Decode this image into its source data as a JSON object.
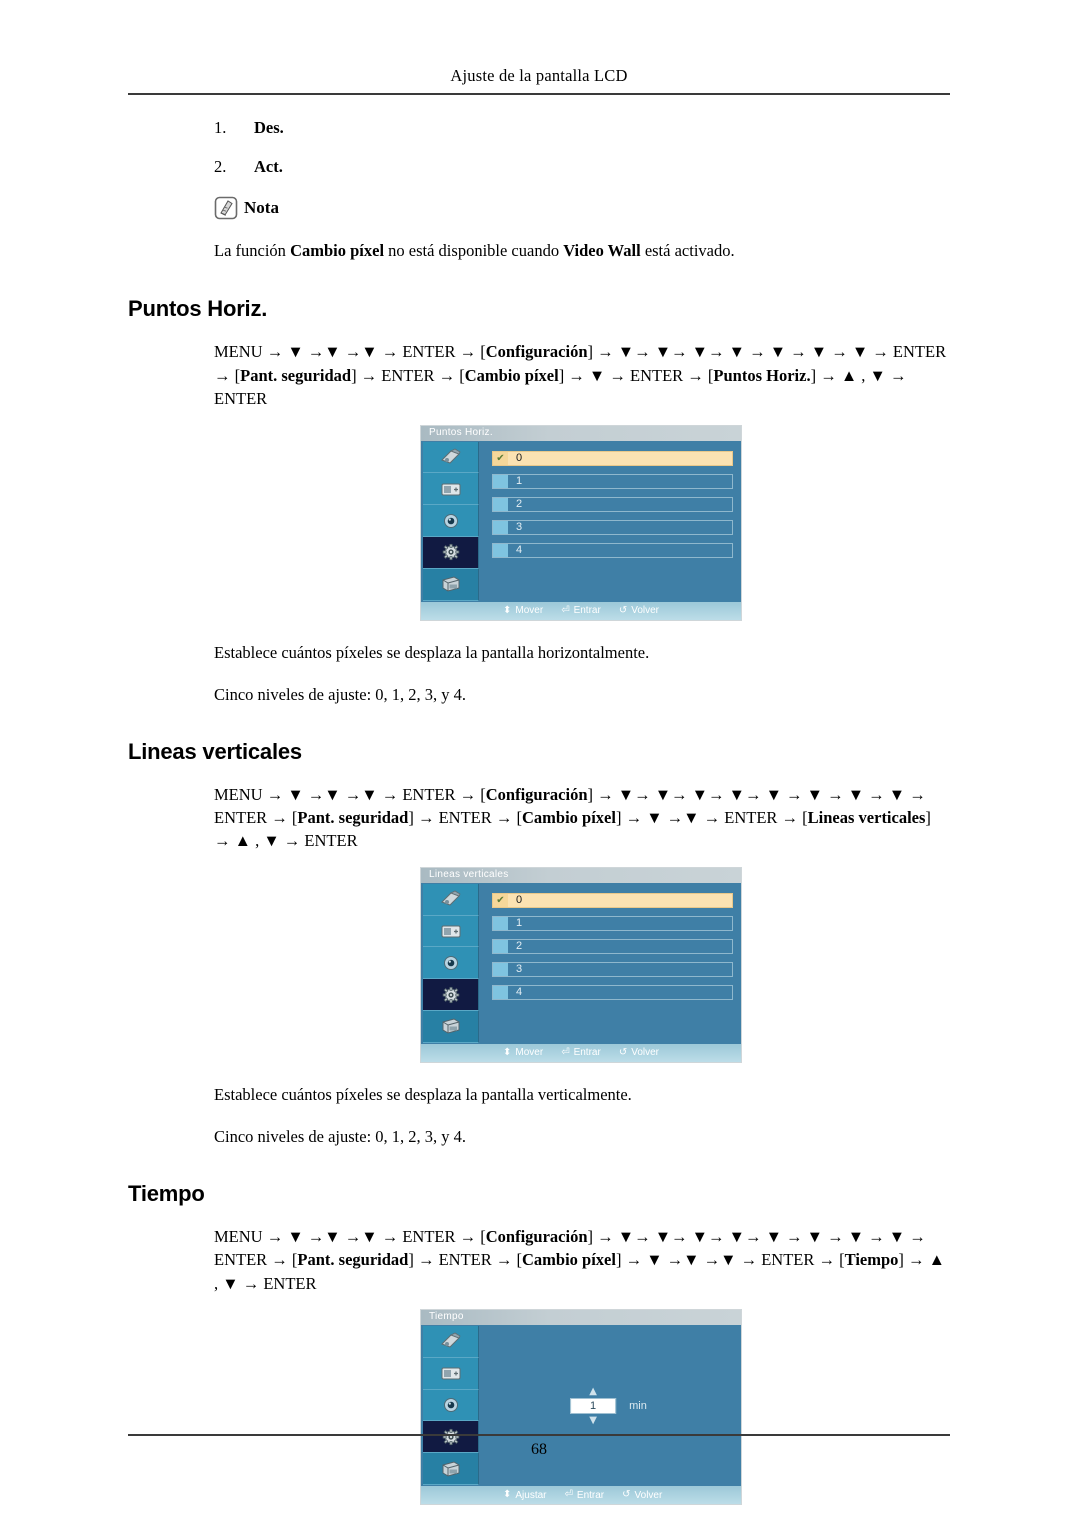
{
  "header": {
    "title": "Ajuste de la pantalla LCD"
  },
  "intro": {
    "items": [
      {
        "marker": "1.",
        "label": "Des."
      },
      {
        "marker": "2.",
        "label": "Act."
      }
    ],
    "note_icon": "note-pencil-icon",
    "note_label": "Nota",
    "note_text_1": "La función ",
    "note_bold_1": "Cambio píxel",
    "note_text_2": " no está disponible cuando ",
    "note_bold_2": "Video Wall",
    "note_text_3": " está activado."
  },
  "sections": [
    {
      "heading": "Puntos Horiz.",
      "menu_path_html": "MENU → ▼ →▼ →▼ → ENTER → [<b>Configuración</b>] → ▼→ ▼→ ▼→ ▼ → ▼ → ▼ → ▼ → ENTER → [<b>Pant. seguridad</b>] → ENTER → [<b>Cambio píxel</b>] → ▼ → ENTER → [<b>Puntos Horiz.</b>] → ▲ , ▼ → ENTER",
      "osd": {
        "title": "Puntos Horiz.",
        "type": "list",
        "selected_index": 0,
        "rows": [
          "0",
          "1",
          "2",
          "3",
          "4"
        ],
        "check_glyph": "✔",
        "sidebar_selected_index": 3,
        "sidebar_icons": [
          "input-source-icon",
          "picture-icon",
          "sound-icon",
          "setup-gear-icon",
          "multi-control-icon"
        ],
        "footer": [
          {
            "icon": "updown-arrows-icon",
            "glyph": "⬍",
            "label": "Mover"
          },
          {
            "icon": "enter-key-icon",
            "glyph": "⏎",
            "label": "Entrar"
          },
          {
            "icon": "return-arrow-icon",
            "glyph": "↺",
            "label": "Volver"
          }
        ]
      },
      "desc_1": "Establece cuántos píxeles se desplaza la pantalla horizontalmente.",
      "desc_2": "Cinco niveles de ajuste: 0, 1, 2, 3, y 4."
    },
    {
      "heading": "Lineas verticales",
      "menu_path_html": "MENU → ▼ →▼ →▼ → ENTER → [<b>Configuración</b>] → ▼→ ▼→ ▼→ ▼→ ▼ → ▼ → ▼ → ▼ → ENTER → [<b>Pant. seguridad</b>] → ENTER → [<b>Cambio píxel</b>] → ▼ →▼ → ENTER → [<b>Lineas verticales</b>] → ▲ , ▼ → ENTER",
      "osd": {
        "title": "Lineas verticales",
        "type": "list",
        "selected_index": 0,
        "rows": [
          "0",
          "1",
          "2",
          "3",
          "4"
        ],
        "check_glyph": "✔",
        "sidebar_selected_index": 3,
        "sidebar_icons": [
          "input-source-icon",
          "picture-icon",
          "sound-icon",
          "setup-gear-icon",
          "multi-control-icon"
        ],
        "footer": [
          {
            "icon": "updown-arrows-icon",
            "glyph": "⬍",
            "label": "Mover"
          },
          {
            "icon": "enter-key-icon",
            "glyph": "⏎",
            "label": "Entrar"
          },
          {
            "icon": "return-arrow-icon",
            "glyph": "↺",
            "label": "Volver"
          }
        ]
      },
      "desc_1": "Establece cuántos píxeles se desplaza la pantalla verticalmente.",
      "desc_2": "Cinco niveles de ajuste: 0, 1, 2, 3, y 4."
    },
    {
      "heading": "Tiempo",
      "menu_path_html": "MENU → ▼ →▼ →▼ → ENTER → [<b>Configuración</b>] → ▼→ ▼→ ▼→ ▼→ ▼ → ▼ → ▼ → ▼ → ENTER → [<b>Pant. seguridad</b>] → ENTER → [<b>Cambio píxel</b>] → ▼ →▼ →▼ → ENTER → [<b>Tiempo</b>] → ▲ , ▼ → ENTER",
      "osd": {
        "title": "Tiempo",
        "type": "spinner",
        "spinner_value": "1",
        "spinner_unit": "min",
        "up_glyph": "▲",
        "down_glyph": "▼",
        "sidebar_selected_index": 3,
        "sidebar_icons": [
          "input-source-icon",
          "picture-icon",
          "sound-icon",
          "setup-gear-icon",
          "multi-control-icon"
        ],
        "footer": [
          {
            "icon": "updown-arrows-icon",
            "glyph": "⬍",
            "label": "Ajustar"
          },
          {
            "icon": "enter-key-icon",
            "glyph": "⏎",
            "label": "Entrar"
          },
          {
            "icon": "return-arrow-icon",
            "glyph": "↺",
            "label": "Volver"
          }
        ]
      },
      "desc_1": "",
      "desc_2": ""
    }
  ],
  "footer": {
    "page_number": "68"
  }
}
